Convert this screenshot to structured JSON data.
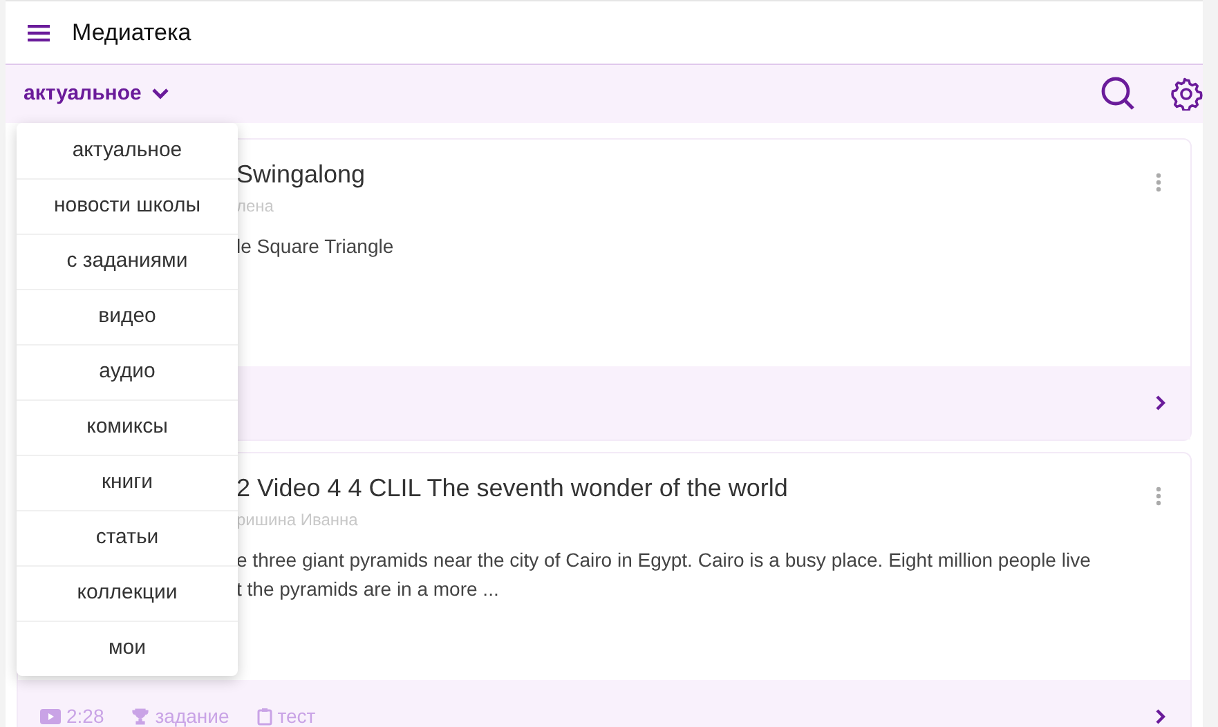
{
  "header": {
    "title": "Медиатека"
  },
  "filter": {
    "label": "актуальное",
    "expanded": true
  },
  "menu": [
    {
      "label": "актуальное"
    },
    {
      "label": "новости школы"
    },
    {
      "label": "с заданиями"
    },
    {
      "label": "видео"
    },
    {
      "label": "аудио"
    },
    {
      "label": "комиксы"
    },
    {
      "label": "книги"
    },
    {
      "label": "статьи"
    },
    {
      "label": "коллекции"
    },
    {
      "label": "мои"
    }
  ],
  "cards": [
    {
      "title": "Swingalong",
      "author": "лена",
      "description_lines": [
        "le Square Triangle"
      ]
    },
    {
      "title": "2 Video 4 4 CLIL The seventh wonder of the world",
      "author": "ришина Иванна",
      "description_lines": [
        "e three giant pyramids near the city of Cairo in Egypt. Cairo is a busy place. Eight million people live",
        "t the pyramids are in a more ..."
      ],
      "footer": [
        {
          "kind": "video",
          "text": "2:28"
        },
        {
          "kind": "task",
          "text": "задание"
        },
        {
          "kind": "test",
          "text": "тест"
        }
      ]
    }
  ]
}
